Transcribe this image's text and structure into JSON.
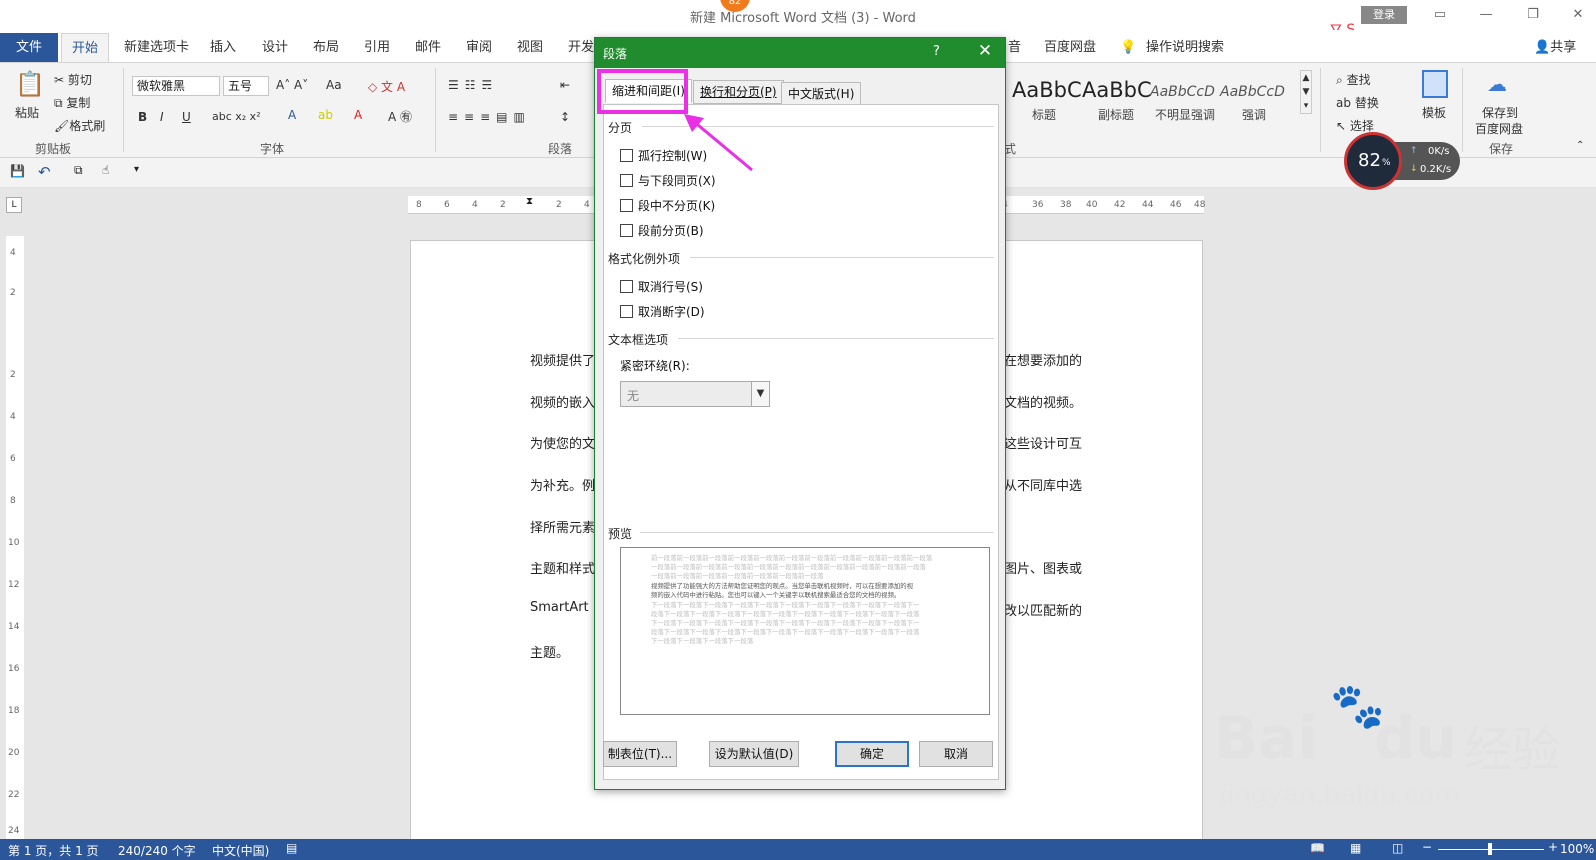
{
  "window": {
    "title": "新建 Microsoft Word 文档 (3)  -  Word",
    "login_label": "登录",
    "share_label": "共享"
  },
  "ribbon_tabs": [
    "文件",
    "开始",
    "新建选项卡",
    "插入",
    "设计",
    "布局",
    "引用",
    "邮件",
    "审阅",
    "视图",
    "开发",
    "音",
    "百度网盘"
  ],
  "tell_me": "操作说明搜索",
  "clipboard": {
    "paste": "粘贴",
    "cut": "剪切",
    "copy": "复制",
    "format_painter": "格式刷",
    "group": "剪贴板"
  },
  "font": {
    "name": "微软雅黑",
    "size": "五号",
    "case_btn": "Aa",
    "group": "字体"
  },
  "paragraph": {
    "group": "段落"
  },
  "styles": {
    "items": [
      {
        "sample": "AaBbC",
        "name": "标题"
      },
      {
        "sample": "AaBbC",
        "name": "副标题"
      },
      {
        "sample": "AaBbCcD",
        "name": "不明显强调"
      },
      {
        "sample": "AaBbCcD",
        "name": "强调"
      }
    ],
    "group": "式"
  },
  "editing": {
    "find": "查找",
    "replace": "替换",
    "select": "选择",
    "group": "编辑"
  },
  "template": {
    "label": "模板"
  },
  "baidu": {
    "save_line1": "保存到",
    "save_line2": "百度网盘",
    "group": "保存"
  },
  "speed_widget": {
    "percent": "82",
    "unit": "%",
    "up": "0K/s",
    "down": "0.2K/s"
  },
  "badge": "82",
  "ruler": {
    "h_left": [
      "8",
      "6",
      "4",
      "2",
      "2",
      "4"
    ],
    "h_right": [
      "4",
      "36",
      "38",
      "40",
      "42",
      "44",
      "46",
      "48"
    ],
    "v": [
      "4",
      "2",
      "2",
      "4",
      "6",
      "8",
      "10",
      "12",
      "14",
      "16",
      "18",
      "20",
      "22",
      "24"
    ]
  },
  "document": {
    "left": [
      "视频提供了",
      "视频的嵌入",
      "为使您的文",
      "为补充。例",
      "择所需元素",
      "主题和样式",
      "SmartArt",
      "主题。"
    ],
    "right": [
      "在想要添加的",
      "文档的视频。",
      "这些设计可互",
      "从不同库中选",
      "",
      "图片、图表或",
      "改以匹配新的",
      ""
    ]
  },
  "status": {
    "page": "第 1 页，共 1 页",
    "words": "240/240 个字",
    "lang": "中文(中国)",
    "zoom": "100%"
  },
  "dialog": {
    "title": "段落",
    "help": "?",
    "tabs": [
      "缩进和间距(I)",
      "换行和分页(P)",
      "中文版式(H)"
    ],
    "pagination": {
      "heading": "分页",
      "items": [
        "孤行控制(W)",
        "与下段同页(X)",
        "段中不分页(K)",
        "段前分页(B)"
      ]
    },
    "exceptions": {
      "heading": "格式化例外项",
      "items": [
        "取消行号(S)",
        "取消断字(D)"
      ]
    },
    "textbox": {
      "heading": "文本框选项",
      "wrap_label": "紧密环绕(R):",
      "wrap_value": "无"
    },
    "preview": {
      "heading": "预览",
      "lines": [
        "前一段落前一段落前一段落前一段落前一段落前一段落前一段落前一段落前一段落前一段落前一段落",
        "一段落前一段落前一段落前一段落前一段落前一段落前一段落前一段落前一段落前一段落前一段落",
        "一段落前一段落前一段落前一段落前一段落前一段落前一段落",
        "视频提供了功能强大的方法帮助您证明您的观点。当您单击联机视频时，可以在想要添加的视",
        "频的嵌入代码中进行粘贴。您也可以键入一个关键字以联机搜索最适合您的文档的视频。",
        "下一段落下一段落下一段落下一段落下一段落下一段落下一段落下一段落下一段落下一段落下一",
        "段落下一段落下一段落下一段落下一段落下一段落下一段落下一段落下一段落下一段落下一段落",
        "下一段落下一段落下一段落下一段落下一段落下一段落下一段落下一段落下一段落下一段落下一",
        "段落下一段落下一段落下一段落下一段落下一段落下一段落下一段落下一段落下一段落下一段落",
        "下一段落下一段落下一段落下一段落"
      ]
    },
    "buttons": {
      "tabs": "制表位(T)...",
      "default": "设为默认值(D)",
      "ok": "确定",
      "cancel": "取消"
    }
  },
  "watermark": {
    "brand": "Bai",
    "brand2": "du",
    "cn": "经验",
    "url": "jingyan.baidu.com"
  },
  "colors": {
    "word_blue": "#2b579a",
    "dialog_green": "#218c2e",
    "highlight": "#ea2fe6"
  }
}
